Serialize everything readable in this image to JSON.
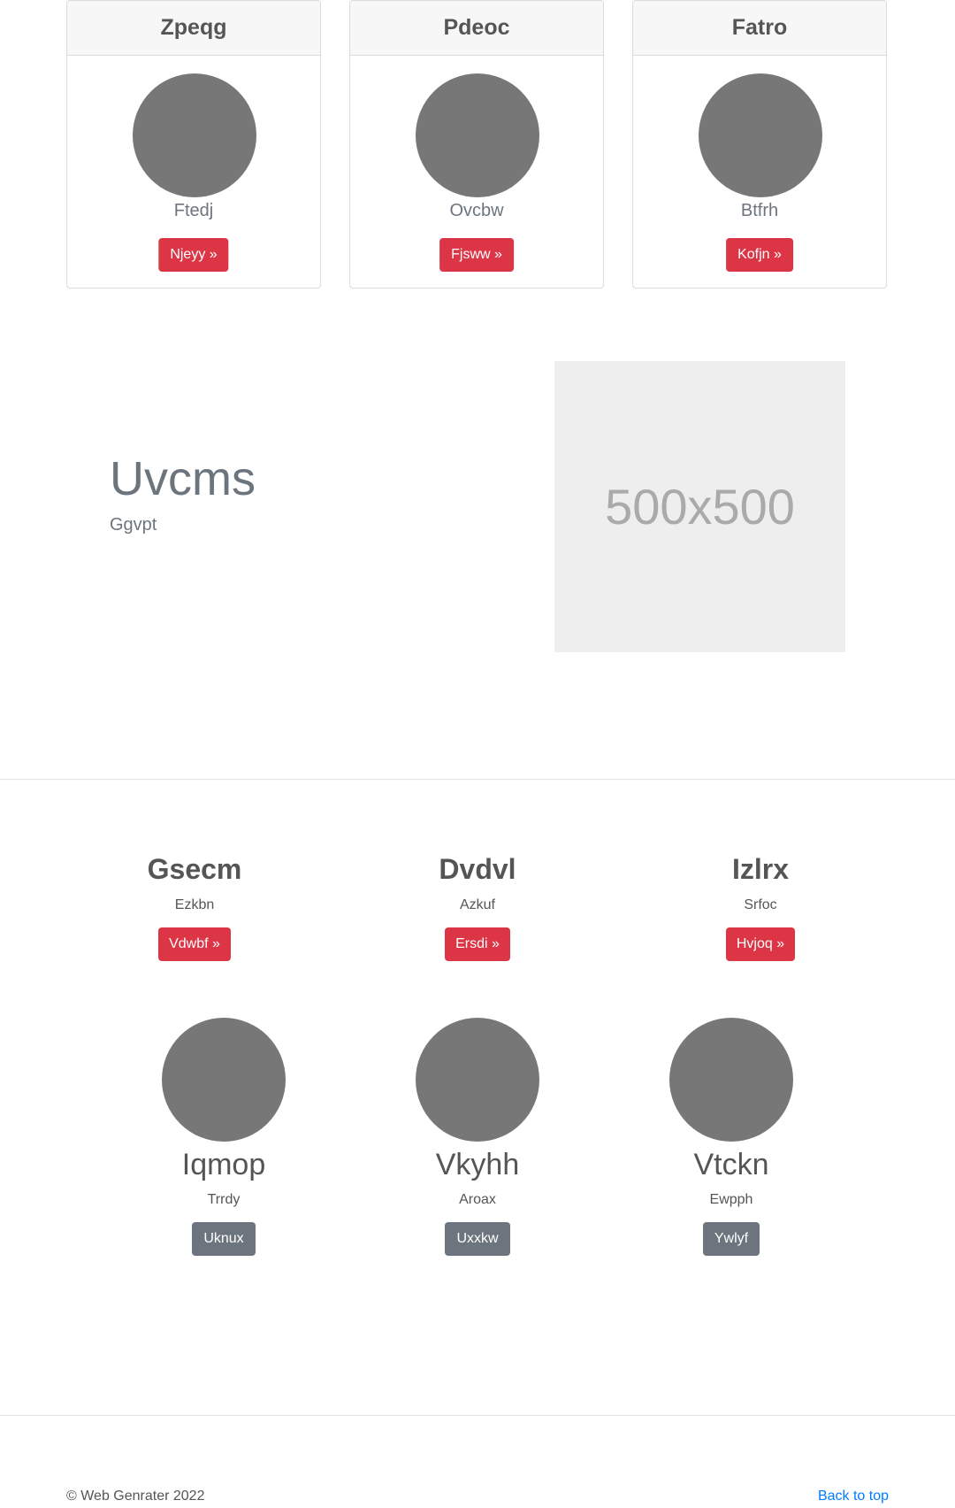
{
  "cards": [
    {
      "title": "Zpeqg",
      "subtitle": "Ftedj",
      "button": "Njeyy »"
    },
    {
      "title": "Pdeoc",
      "subtitle": "Ovcbw",
      "button": "Fjsww »"
    },
    {
      "title": "Fatro",
      "subtitle": "Btfrh",
      "button": "Kofjn »"
    }
  ],
  "feature": {
    "heading": "Uvcms",
    "subheading": "Ggvpt",
    "image_placeholder": "500x500"
  },
  "columns": [
    {
      "heading": "Gsecm",
      "text": "Ezkbn",
      "button": "Vdwbf »"
    },
    {
      "heading": "Dvdvl",
      "text": "Azkuf",
      "button": "Ersdi »"
    },
    {
      "heading": "Izlrx",
      "text": "Srfoc",
      "button": "Hvjoq »"
    }
  ],
  "people": [
    {
      "name": "Iqmop",
      "text": "Trrdy",
      "button": "Uknux"
    },
    {
      "name": "Vkyhh",
      "text": "Aroax",
      "button": "Uxxkw"
    },
    {
      "name": "Vtckn",
      "text": "Ewpph",
      "button": "Ywlyf"
    }
  ],
  "footer": {
    "copyright": "© Web Genrater 2022",
    "back_to_top": "Back to top"
  },
  "colors": {
    "danger": "#dc3545",
    "secondary": "#6c757d",
    "link": "#007bff",
    "avatar": "#777777"
  }
}
